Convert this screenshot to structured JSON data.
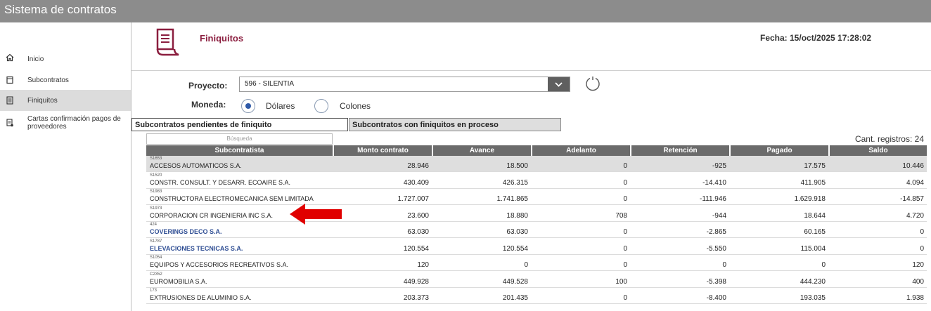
{
  "app": {
    "title": "Sistema de contratos"
  },
  "sidebar": {
    "items": [
      {
        "label": "Inicio",
        "icon": "home-icon"
      },
      {
        "label": "Subcontratos",
        "icon": "document-icon"
      },
      {
        "label": "Finiquitos",
        "icon": "list-document-icon",
        "active": true
      },
      {
        "label": "Cartas confirmación pagos de proveedores",
        "icon": "receipt-icon"
      }
    ]
  },
  "header": {
    "title": "Finiquitos",
    "fecha": "Fecha: 15/oct/2025 17:28:02",
    "accent": "#8b1e3f"
  },
  "form": {
    "proyecto_label": "Proyecto:",
    "proyecto_value": "596 - SILENTIA",
    "moneda_label": "Moneda:",
    "options": [
      {
        "label": "Dólares",
        "selected": true
      },
      {
        "label": "Colones",
        "selected": false
      }
    ]
  },
  "tabs": [
    {
      "label": "Subcontratos pendientes de finiquito",
      "active": true
    },
    {
      "label": "Subcontratos con finiquitos en proceso",
      "active": false
    }
  ],
  "search": {
    "placeholder": "Búsqueda"
  },
  "cant": "Cant. registros: 24",
  "table": {
    "columns": [
      "Subcontratista",
      "Monto contrato",
      "Avance",
      "Adelanto",
      "Retención",
      "Pagado",
      "Saldo"
    ],
    "rows": [
      {
        "code": "S1653",
        "name": "ACCESOS AUTOMATICOS S.A.",
        "link": false,
        "monto": "28.946",
        "avance": "18.500",
        "adelanto": "0",
        "retencion": "-925",
        "pagado": "17.575",
        "saldo": "10.446"
      },
      {
        "code": "S1520",
        "name": "CONSTR. CONSULT. Y DESARR. ECOAIRE S.A.",
        "link": false,
        "monto": "430.409",
        "avance": "426.315",
        "adelanto": "0",
        "retencion": "-14.410",
        "pagado": "411.905",
        "saldo": "4.094"
      },
      {
        "code": "S1983",
        "name": "CONSTRUCTORA ELECTROMECANICA SEM LIMITADA",
        "link": false,
        "monto": "1.727.007",
        "avance": "1.741.865",
        "adelanto": "0",
        "retencion": "-111.946",
        "pagado": "1.629.918",
        "saldo": "-14.857"
      },
      {
        "code": "S1973",
        "name": "CORPORACION CR INGENIERIA INC S.A.",
        "link": false,
        "monto": "23.600",
        "avance": "18.880",
        "adelanto": "708",
        "retencion": "-944",
        "pagado": "18.644",
        "saldo": "4.720"
      },
      {
        "code": "424",
        "name": "COVERINGS DECO S.A.",
        "link": true,
        "monto": "63.030",
        "avance": "63.030",
        "adelanto": "0",
        "retencion": "-2.865",
        "pagado": "60.165",
        "saldo": "0"
      },
      {
        "code": "S1787",
        "name": "ELEVACIONES TECNICAS S.A.",
        "link": true,
        "monto": "120.554",
        "avance": "120.554",
        "adelanto": "0",
        "retencion": "-5.550",
        "pagado": "115.004",
        "saldo": "0"
      },
      {
        "code": "S1054",
        "name": "EQUIPOS Y ACCESORIOS RECREATIVOS S.A.",
        "link": false,
        "monto": "120",
        "avance": "0",
        "adelanto": "0",
        "retencion": "0",
        "pagado": "0",
        "saldo": "120"
      },
      {
        "code": "C2352",
        "name": "EUROMOBILIA S.A.",
        "link": false,
        "monto": "449.928",
        "avance": "449.528",
        "adelanto": "100",
        "retencion": "-5.398",
        "pagado": "444.230",
        "saldo": "400"
      },
      {
        "code": "173",
        "name": "EXTRUSIONES DE ALUMINIO S.A.",
        "link": false,
        "monto": "203.373",
        "avance": "201.435",
        "adelanto": "0",
        "retencion": "-8.400",
        "pagado": "193.035",
        "saldo": "1.938"
      }
    ]
  },
  "annotation": {
    "arrow_color": "#e00000"
  }
}
